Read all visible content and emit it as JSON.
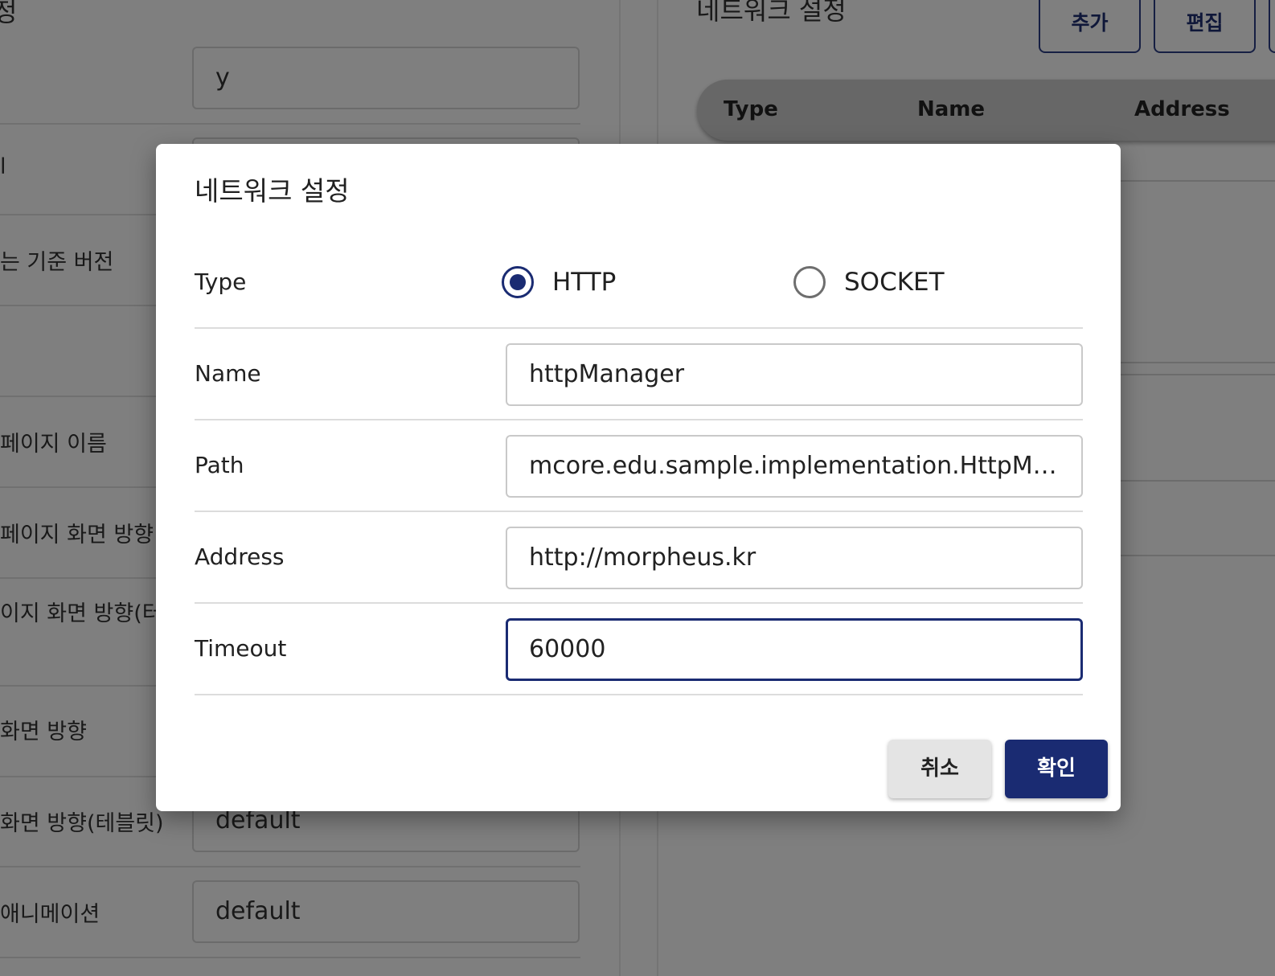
{
  "background": {
    "left_title": "정",
    "left_rows": [
      {
        "label": "",
        "value": "y"
      },
      {
        "label": "l",
        "value": ""
      },
      {
        "label": "는 기준 버전",
        "value": ""
      },
      {
        "label": "",
        "value": ""
      },
      {
        "label": "페이지 이름",
        "value": ""
      },
      {
        "label": "페이지 화면 방향",
        "value": ""
      },
      {
        "label": "이지 화면 방향(터",
        "value": ""
      },
      {
        "label": "화면 방향",
        "value": ""
      },
      {
        "label": "화면 방향(테블릿)",
        "value": "default"
      },
      {
        "label": "애니메이션",
        "value": "default"
      }
    ],
    "right_title": "네트워크 설정",
    "add_button": "추가",
    "edit_button": "편집",
    "table_headers": [
      "Type",
      "Name",
      "Address"
    ]
  },
  "dialog": {
    "title": "네트워크 설정",
    "type_label": "Type",
    "type_options": [
      "HTTP",
      "SOCKET"
    ],
    "type_selected": "HTTP",
    "name_label": "Name",
    "name_value": "httpManager",
    "path_label": "Path",
    "path_value": "mcore.edu.sample.implementation.HttpManager",
    "address_label": "Address",
    "address_value": "http://morpheus.kr",
    "timeout_label": "Timeout",
    "timeout_value": "60000",
    "cancel_label": "취소",
    "confirm_label": "확인"
  },
  "colors": {
    "accent": "#1a2b72",
    "overlay": "rgba(0,0,0,0.5)"
  }
}
